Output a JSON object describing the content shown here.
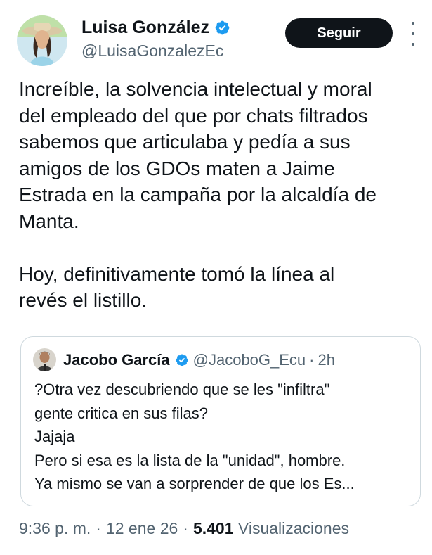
{
  "author": {
    "display_name": "Luisa González",
    "handle": "@LuisaGonzalezEc",
    "verified_icon": "verified-badge-icon",
    "follow_label": "Seguir",
    "more_icon": "more-options-icon"
  },
  "tweet": {
    "paragraphs": [
      "Increíble, la solvencia intelectual y moral\ndel empleado del que por chats filtrados\nsabemos que articulaba y pedía a sus\namigos de los GDOs maten a Jaime\nEstrada en la campaña por la alcaldía de\nManta.",
      "Hoy, definitivamente tomó la línea al\nrevés el listillo."
    ]
  },
  "quoted": {
    "display_name": "Jacobo García",
    "handle": "@JacoboG_Ecu",
    "separator": "·",
    "time": "2h",
    "lines": [
      "?Otra vez descubriendo que se les \"infiltra\"",
      "gente critica en sus filas?",
      "Jajaja",
      "Pero si esa es la lista de la \"unidad\", hombre.",
      "Ya mismo se van a sorprender de que los Es..."
    ]
  },
  "meta": {
    "time": "9:36 p. m.",
    "separator": "·",
    "date": "12 ene 26",
    "views_count": "5.401",
    "views_label": "Visualizaciones"
  },
  "colors": {
    "text_primary": "#0f1419",
    "text_secondary": "#536471",
    "verified_blue": "#1d9bf0",
    "border": "#cfd9de",
    "button_bg": "#0f1419"
  }
}
